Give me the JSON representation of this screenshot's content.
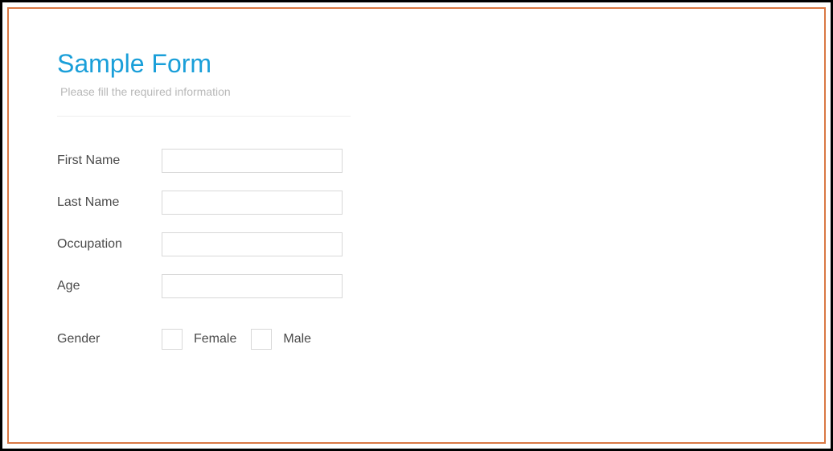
{
  "form": {
    "title": "Sample Form",
    "subtitle": "Please fill the required information",
    "fields": {
      "firstName": {
        "label": "First Name",
        "value": ""
      },
      "lastName": {
        "label": "Last Name",
        "value": ""
      },
      "occupation": {
        "label": "Occupation",
        "value": ""
      },
      "age": {
        "label": "Age",
        "value": ""
      },
      "gender": {
        "label": "Gender",
        "options": {
          "female": "Female",
          "male": "Male"
        }
      }
    }
  }
}
